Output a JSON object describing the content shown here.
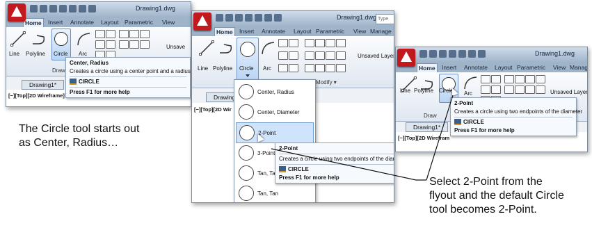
{
  "shot1": {
    "title": "Drawing1.dwg",
    "tabs": [
      "Home",
      "Insert",
      "Annotate",
      "Layout",
      "Parametric",
      "View"
    ],
    "tools": {
      "line": "Line",
      "polyline": "Polyline",
      "circle": "Circle",
      "arc": "Arc",
      "draw_panel": "Draw",
      "layer": "Unsave"
    },
    "tooltip": {
      "title": "Center, Radius",
      "description": "Creates a circle using a center point and a radius",
      "command": "CIRCLE",
      "help": "Press F1 for more help"
    },
    "doc_tab": "Drawing1*",
    "viewport_label": "[−][Top][2D Wireframe]"
  },
  "shot2": {
    "title": "Drawing1.dwg",
    "search_placeholder": "Type",
    "tabs": [
      "Home",
      "Insert",
      "Annotate",
      "Layout",
      "Parametric",
      "View",
      "Manage"
    ],
    "tools": {
      "line": "Line",
      "polyline": "Polyline",
      "circle": "Circle",
      "arc": "Arc",
      "layer": "Unsaved Layer",
      "modify_panel": "Modify ▾"
    },
    "doc_tab": "Drawing1*",
    "viewport_label": "[−][Top][2D Wir",
    "flyout_items": [
      "Center, Radius",
      "Center, Diameter",
      "2-Point",
      "3-Point",
      "Tan, Tan",
      "Tan, Tan"
    ],
    "tooltip": {
      "title": "2-Point",
      "description": "Creates a circle using two endpoints of the diameter",
      "command": "CIRCLE",
      "help": "Press F1 for more help"
    }
  },
  "shot3": {
    "title": "Drawing1.dwg",
    "tabs": [
      "Home",
      "Insert",
      "Annotate",
      "Layout",
      "Parametric",
      "View",
      "Manag"
    ],
    "tools": {
      "line": "Line",
      "polyline": "Polyline",
      "circle": "Circle",
      "arc": "Arc",
      "layer": "Unsaved Layer",
      "draw_panel": "Draw"
    },
    "tooltip": {
      "title": "2-Point",
      "description": "Creates a circle using two endpoints of the diameter",
      "command": "CIRCLE",
      "help": "Press F1 for more help"
    },
    "doc_tab": "Drawing1*",
    "viewport_label": "[−][Top][2D Wirefram"
  },
  "captions": {
    "left": [
      "The Circle tool starts out",
      "as Center, Radius…"
    ],
    "right": [
      "Select 2-Point from the",
      "flyout and the default Circle",
      "tool becomes 2-Point."
    ]
  },
  "colors": {
    "app_button": "#c0191e",
    "selection": "#cfe3fb",
    "ribbon_bg": "#eef2f7"
  }
}
